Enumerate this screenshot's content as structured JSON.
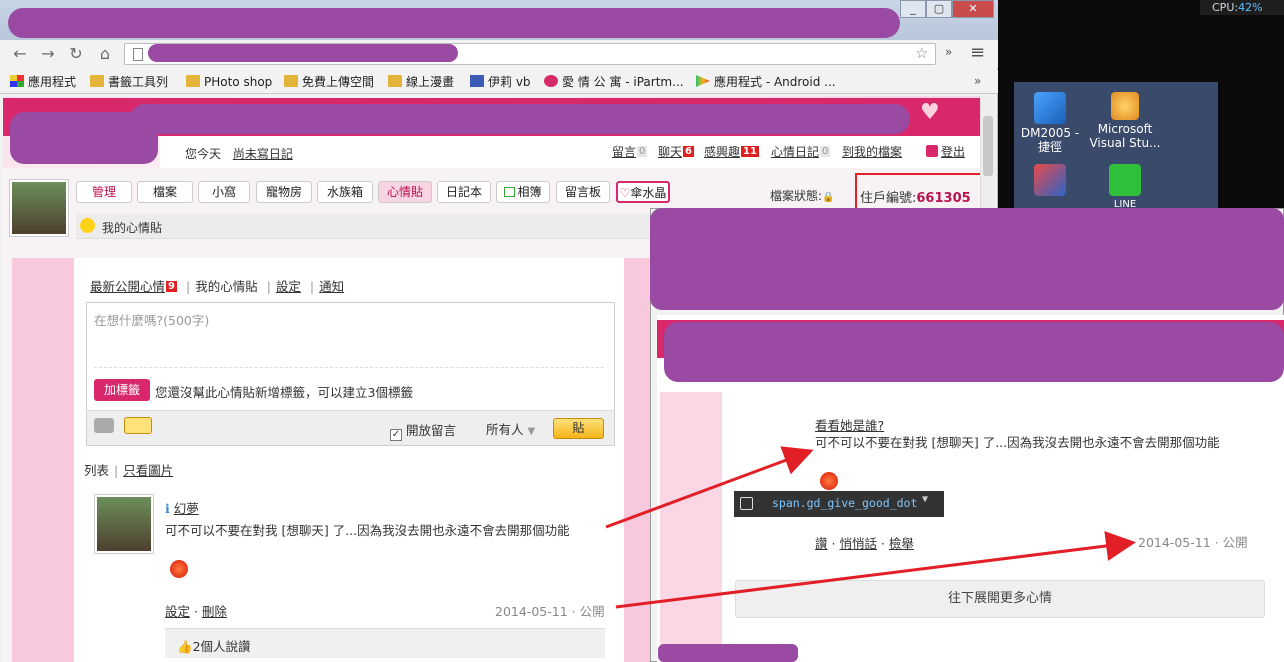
{
  "system": {
    "cpu_label": "CPU:",
    "cpu_value": "42%"
  },
  "desktop_icons": [
    {
      "label_line1": "DM2005 -",
      "label_line2": "捷徑"
    },
    {
      "label_line1": "Microsoft",
      "label_line2": "Visual Stu..."
    },
    {
      "label_line1": "LINE",
      "label_line2": ""
    }
  ],
  "browser": {
    "window_buttons": [
      "_",
      "▢",
      "✕"
    ],
    "nav_buttons": {
      "back": "←",
      "forward": "→",
      "reload": "↻",
      "home": "⌂"
    },
    "menu_icon": "≡",
    "overflow": "»",
    "bookmarks": [
      {
        "label": "應用程式",
        "icon": "apps-icon"
      },
      {
        "label": "書籤工具列",
        "icon": "folder-icon"
      },
      {
        "label": "PHoto shop",
        "icon": "folder-icon"
      },
      {
        "label": "免費上傳空間",
        "icon": "folder-icon"
      },
      {
        "label": "線上漫畫",
        "icon": "folder-icon"
      },
      {
        "label": "伊莉 vb",
        "icon": "eyny-icon"
      },
      {
        "label": "愛 情 公 寓 - iPartm...",
        "icon": "ipart-icon"
      },
      {
        "label": "應用程式 - Android ...",
        "icon": "play-icon"
      }
    ]
  },
  "site": {
    "today_text": "您今天",
    "today_link": "尚未寫日記",
    "header_links": [
      {
        "label": "留言",
        "count": "0",
        "hot": false
      },
      {
        "label": "聊天",
        "count": "6",
        "hot": true
      },
      {
        "label": "感興趣",
        "count": "11",
        "hot": true
      },
      {
        "label": "心情日記",
        "count": "0",
        "hot": false
      },
      {
        "label": "到我的檔案",
        "count": "",
        "hot": false
      },
      {
        "label": "登出",
        "count": "",
        "hot": false
      }
    ],
    "tabs": [
      "管理",
      "檔案",
      "小窩",
      "寵物房",
      "水族箱",
      "心情貼",
      "日記本",
      "相簿",
      "留言板",
      "傘水晶"
    ],
    "profile_status_label": "檔案狀態:",
    "resident_id_label": "住戶編號:",
    "resident_id": "661305",
    "section_title": "我的心情貼",
    "subnav": {
      "latest": "最新公開心情",
      "latest_count": "9",
      "mine": "我的心情貼",
      "settings": "設定",
      "notify": "通知"
    },
    "composer": {
      "placeholder": "在想什麼嗎?(500字)",
      "tag_button": "加標籤",
      "tag_hint": "您還沒幫此心情貼新增標籤，可以建立3個標籤",
      "open_comments_label": "開放留言",
      "audience": "所有人",
      "post_button": "貼"
    },
    "view_toggle": {
      "list": "列表",
      "photos_only": "只看圖片"
    },
    "post": {
      "author": "幻夢",
      "text": "可不可以不要在對我 [想聊天] 了...因為我沒去開也永遠不會去開那個功能",
      "actions": {
        "settings": "設定",
        "delete": "刪除"
      },
      "date": "2014-05-11",
      "visibility": "公開",
      "likes_text": "2個人說讚"
    }
  },
  "popup": {
    "who_link": "看看她是誰?",
    "text": "可不可以不要在對我 [想聊天] 了...因為我沒去開也永遠不會去開那個功能",
    "tooltip": "span.gd_give_good_dot",
    "actions": {
      "like": "讚",
      "whisper": "悄悄話",
      "report": "檢舉"
    },
    "date": "2014-05-11",
    "visibility": "公開",
    "more_button": "往下展開更多心情"
  },
  "colors": {
    "brand_pink": "#d9276b",
    "redact_purple": "#9b4aa3",
    "annotation_red": "#e21f26"
  }
}
